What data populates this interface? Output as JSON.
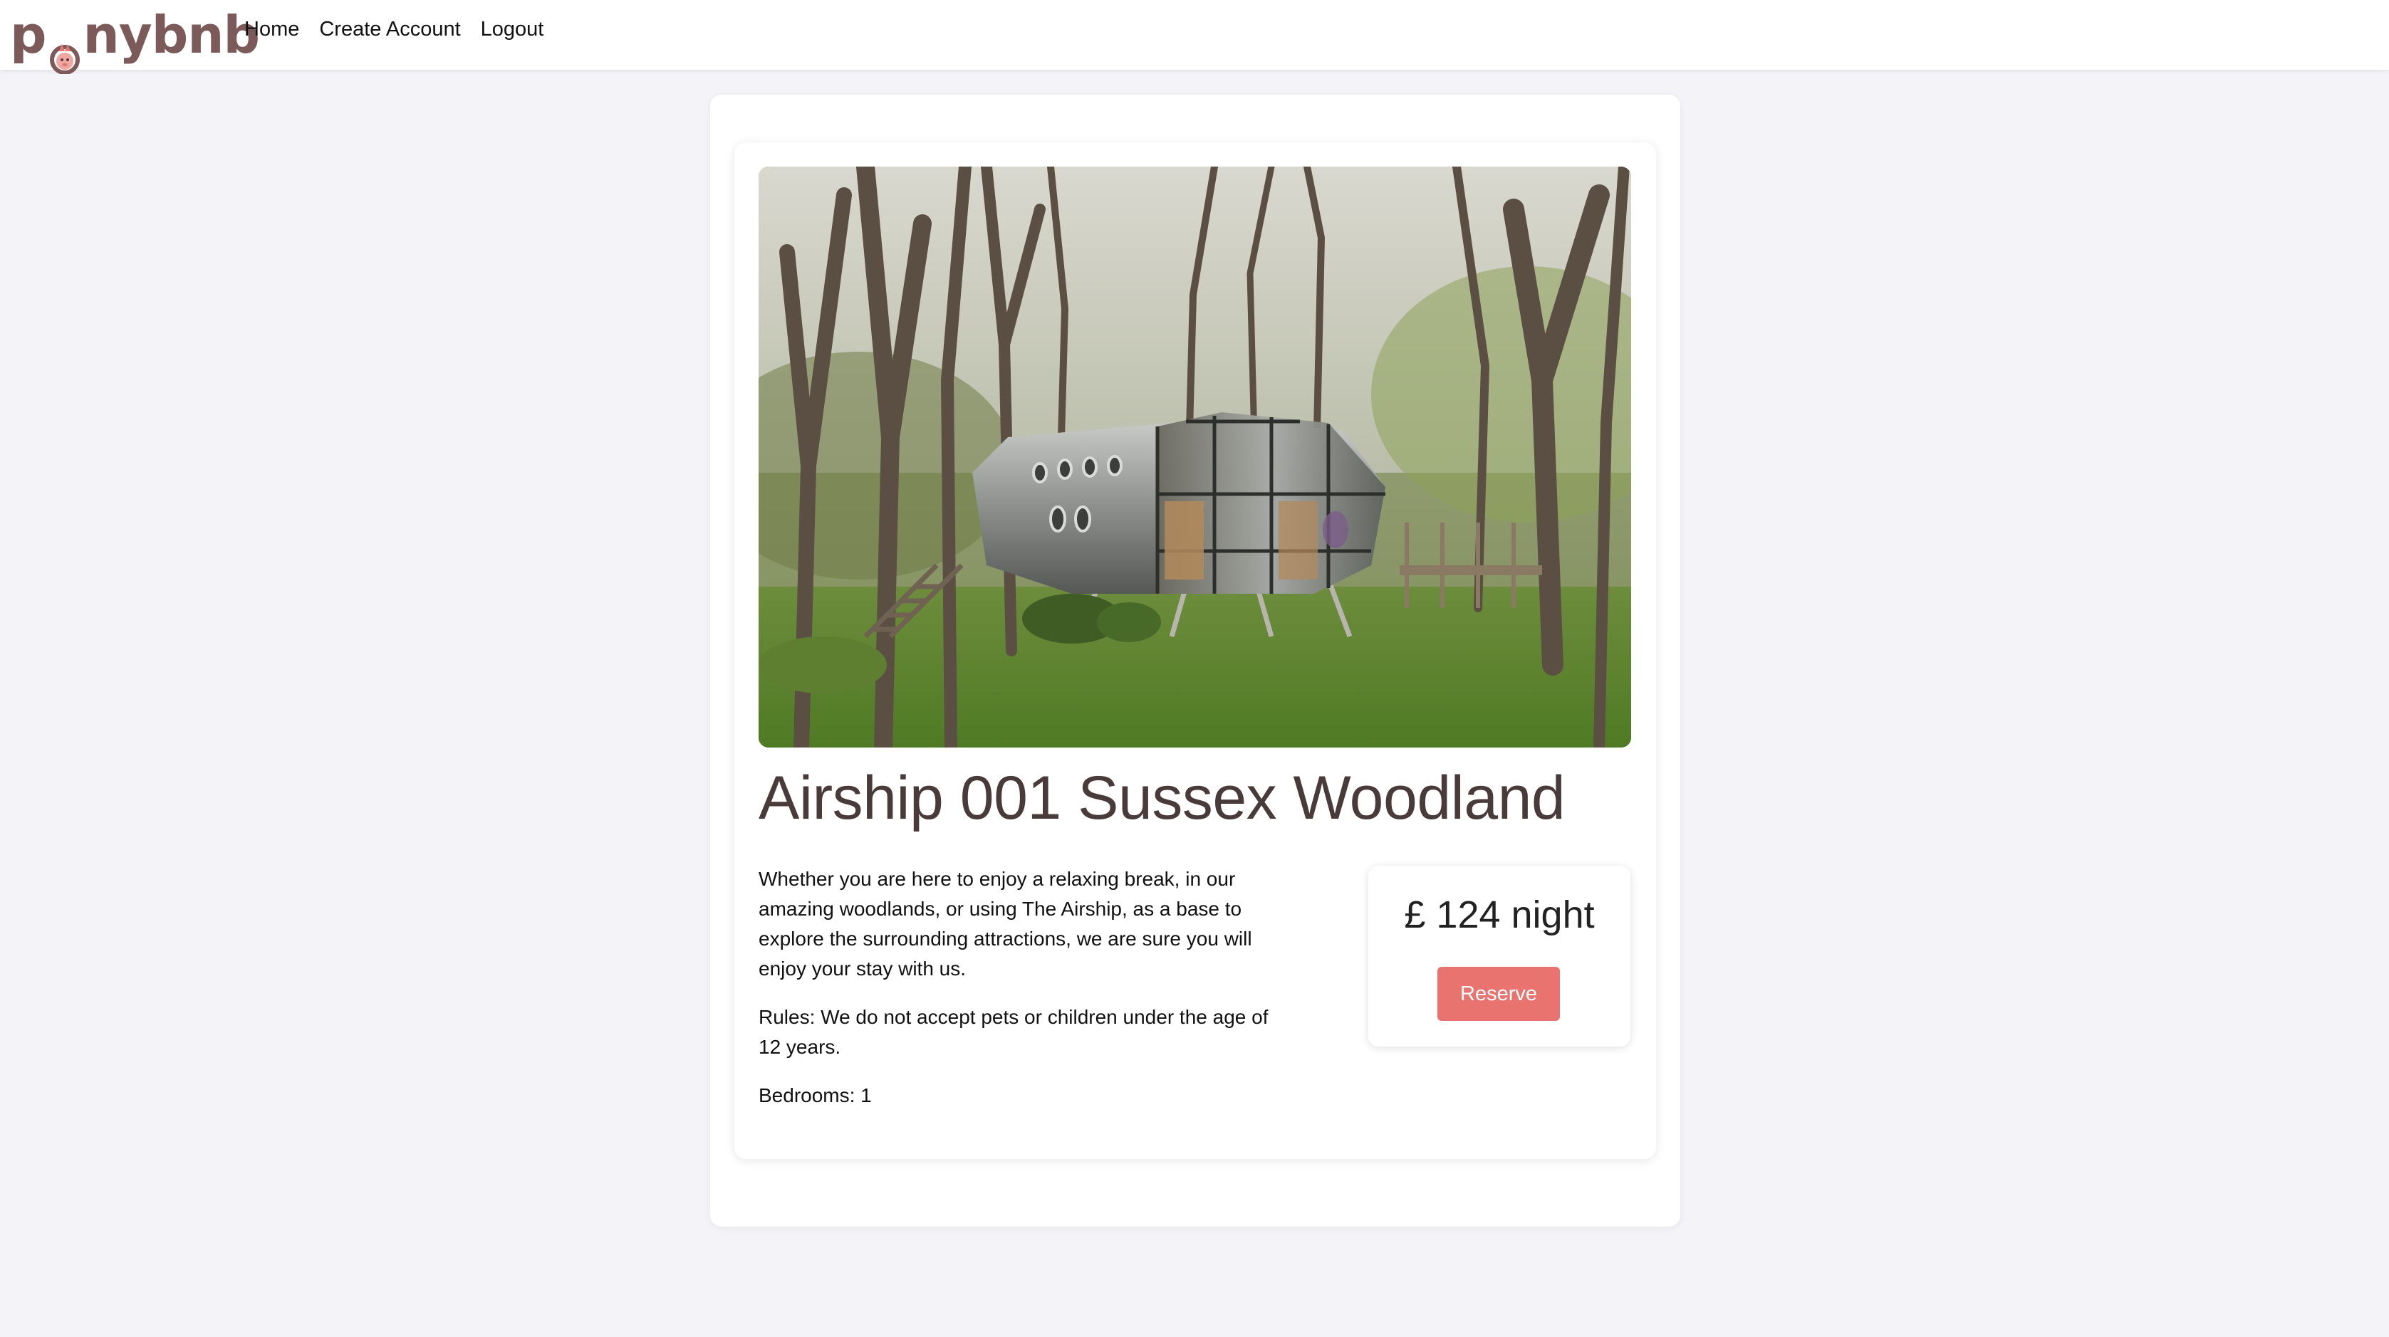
{
  "brand": {
    "logo_prefix": "p",
    "logo_rest": "nybnb",
    "logo_color": "#7d5a5a",
    "accent_color": "#e8736f"
  },
  "nav": {
    "items": [
      "Home",
      "Create Account",
      "Logout"
    ]
  },
  "listing": {
    "photo_icon": "airship-cabin-photo",
    "title": "Airship 001 Sussex Woodland",
    "description": "Whether you are here to enjoy a relaxing break, in our amazing woodlands, or using The Airship, as a base to explore the surrounding attractions, we are sure you will enjoy your stay with us.",
    "rules": "Rules: We do not accept pets or children under the age of 12 years.",
    "bedrooms": "Bedrooms: 1"
  },
  "booking": {
    "price": "£ 124 night",
    "reserve_label": "Reserve"
  }
}
